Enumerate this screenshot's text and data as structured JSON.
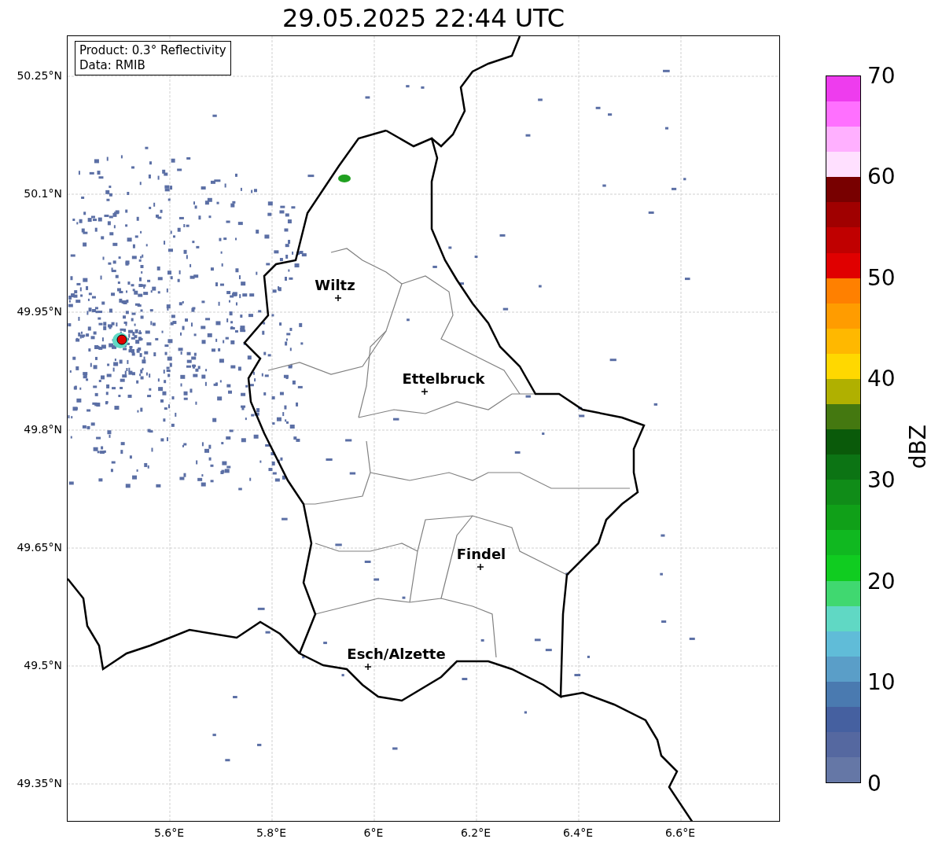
{
  "title": "29.05.2025 22:44 UTC",
  "info_box": {
    "product": "Product: 0.3° Reflectivity",
    "data": "Data: RMIB"
  },
  "map": {
    "kind": "map",
    "y_ticks": [
      "50.25°N",
      "50.1°N",
      "49.95°N",
      "49.8°N",
      "49.65°N",
      "49.5°N",
      "49.35°N"
    ],
    "x_ticks": [
      "5.6°E",
      "5.8°E",
      "6°E",
      "6.2°E",
      "6.4°E",
      "6.6°E"
    ],
    "cities": [
      {
        "name": "Wiltz"
      },
      {
        "name": "Ettelbruck"
      },
      {
        "name": "Findel"
      },
      {
        "name": "Esch/Alzette"
      }
    ]
  },
  "colorbar": {
    "label": "dBZ",
    "ticks": [
      "70",
      "60",
      "50",
      "40",
      "30",
      "20",
      "10",
      "0"
    ],
    "segments": [
      {
        "color": "#ee3cee"
      },
      {
        "color": "#ff70ff"
      },
      {
        "color": "#ffb0ff"
      },
      {
        "color": "#ffe0ff"
      },
      {
        "color": "#780000"
      },
      {
        "color": "#a00000"
      },
      {
        "color": "#c00000"
      },
      {
        "color": "#e00000"
      },
      {
        "color": "#ff8000"
      },
      {
        "color": "#ff9c00"
      },
      {
        "color": "#ffb800"
      },
      {
        "color": "#ffd800"
      },
      {
        "color": "#b0b000"
      },
      {
        "color": "#447810"
      },
      {
        "color": "#0a5a0a"
      },
      {
        "color": "#0c7414"
      },
      {
        "color": "#108c18"
      },
      {
        "color": "#10a018"
      },
      {
        "color": "#10b820"
      },
      {
        "color": "#10cc20"
      },
      {
        "color": "#40d870"
      },
      {
        "color": "#60d8c4"
      },
      {
        "color": "#60bcd8"
      },
      {
        "color": "#5a9ec8"
      },
      {
        "color": "#4a7ab0"
      },
      {
        "color": "#4560a0"
      },
      {
        "color": "#5568a0"
      },
      {
        "color": "#6577a6"
      }
    ]
  }
}
